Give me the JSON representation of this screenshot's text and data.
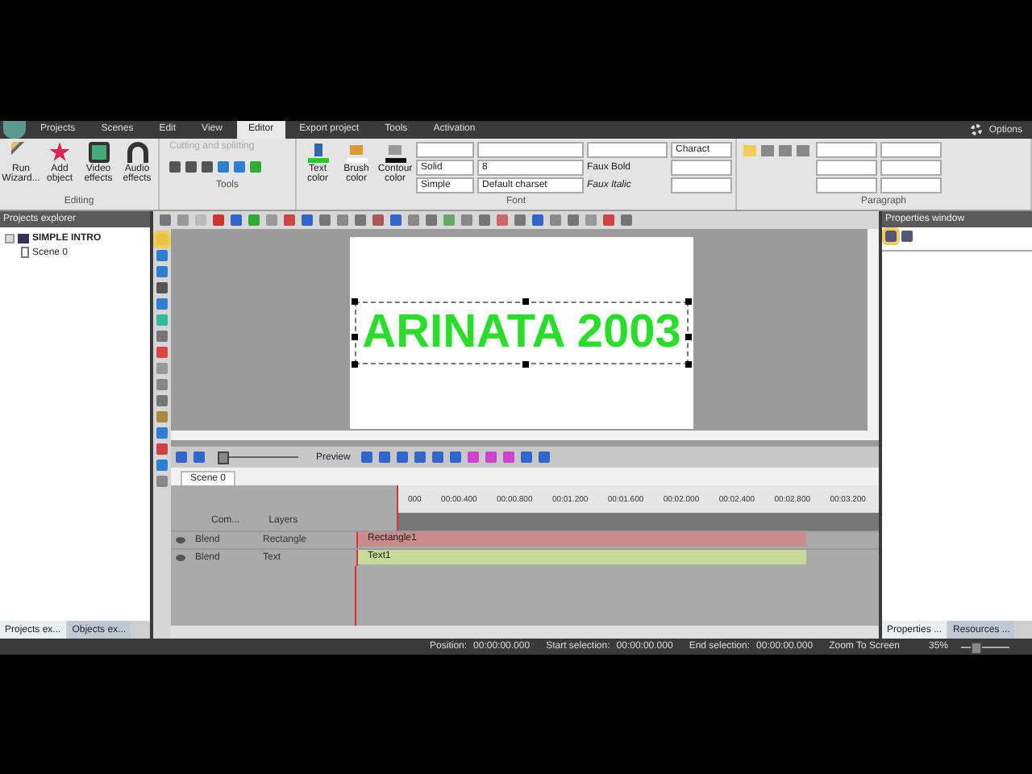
{
  "menu": {
    "tabs": [
      {
        "label": "Projects",
        "selected": false
      },
      {
        "label": "Scenes",
        "selected": false
      },
      {
        "label": "Edit",
        "selected": false
      },
      {
        "label": "View",
        "selected": false
      },
      {
        "label": "Editor",
        "selected": true
      },
      {
        "label": "Export project",
        "selected": false
      },
      {
        "label": "Tools",
        "selected": false
      },
      {
        "label": "Activation",
        "selected": false
      }
    ],
    "options": "Options"
  },
  "ribbon": {
    "editing": {
      "label": "Editing",
      "buttons": [
        "Run Wizard...",
        "Add object",
        "Video effects",
        "Audio effects"
      ]
    },
    "tools": {
      "label": "Tools",
      "cutting": {
        "label": "Cutting and splitting",
        "disabled": true
      }
    },
    "format": {
      "buttons": [
        "Text color",
        "Brush color",
        "Contour color"
      ],
      "fill": "Solid",
      "contour": "Simple"
    },
    "font": {
      "label": "Font",
      "size": "8",
      "charset": "Default charset",
      "faux_bold": "Faux Bold",
      "faux_italic": "Faux Italic",
      "spacing": "Charact"
    },
    "paragraph": {
      "label": "Paragraph",
      "align": [
        {
          "selected": true
        },
        {
          "selected": false
        },
        {
          "selected": false
        },
        {
          "selected": false
        }
      ]
    }
  },
  "explorer": {
    "title": "Projects explorer",
    "tree": [
      {
        "label": "SIMPLE INTRO",
        "expanded": true,
        "children": [
          {
            "label": "Scene 0"
          }
        ]
      }
    ],
    "tabs": [
      {
        "label": "Projects ex...",
        "selected": true
      },
      {
        "label": "Objects ex...",
        "selected": false
      }
    ]
  },
  "canvas": {
    "text": "ARINATA 2003",
    "selected": true
  },
  "timeline": {
    "zoom_slider": {
      "level": 0.05
    },
    "preview": "Preview",
    "scene_tab": "Scene 0",
    "columns": [
      "Com...",
      "Layers"
    ],
    "ticks": [
      "000",
      "00:00.400",
      "00:00.800",
      "00:01.200",
      "00:01.600",
      "00:02.000",
      "00:02.400",
      "00:02.800",
      "00:03.200"
    ],
    "layers": [
      {
        "blend": "Blend",
        "name": "Rectangle",
        "clip": "Rectangle1",
        "color": "#c98b8b"
      },
      {
        "blend": "Blend",
        "name": "Text",
        "clip": "Text1",
        "color": "#c8d99a"
      }
    ]
  },
  "properties": {
    "title": "Properties window",
    "tabs": [
      {
        "label": "Properties ...",
        "selected": true
      },
      {
        "label": "Resources ...",
        "selected": false
      }
    ]
  },
  "status": {
    "items": [
      {
        "label": "Position:",
        "value": "00:00:00.000"
      },
      {
        "label": "Start selection:",
        "value": "00:00:00.000"
      },
      {
        "label": "End selection:",
        "value": "00:00:00.000"
      }
    ],
    "zoom_to_screen": "Zoom To Screen",
    "zoom": "35%",
    "zoom_slider": {
      "level": 0.3
    }
  }
}
